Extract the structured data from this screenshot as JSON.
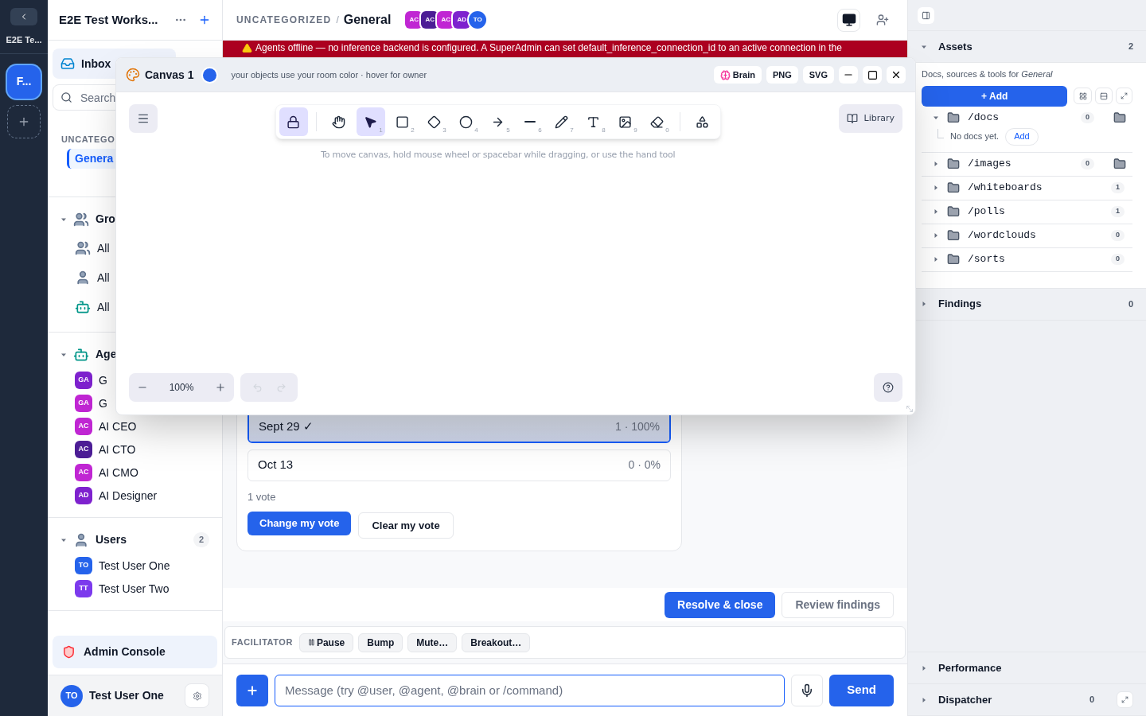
{
  "rail": {
    "title": "E2E Te...",
    "workspaces": [
      {
        "label": "F...",
        "selected": true
      }
    ]
  },
  "sidebar": {
    "workspace_title": "E2E Test Works...",
    "inbox": "Inbox",
    "search": {
      "placeholder": "Search"
    },
    "category": "UNCATEGO",
    "channels": [
      {
        "name": "Genera",
        "selected": true
      }
    ],
    "sections": [
      {
        "title": "Gro",
        "kind": "group",
        "expanded": true,
        "items": [
          {
            "kind": "group",
            "name": "All"
          },
          {
            "kind": "user",
            "name": "All"
          },
          {
            "kind": "robot",
            "name": "All"
          }
        ]
      },
      {
        "title": "Age",
        "kind": "robot",
        "expanded": true,
        "items": [
          {
            "kind": "avatar",
            "initials": "GA",
            "color": "#7e22ce",
            "name": "G"
          },
          {
            "kind": "avatar",
            "initials": "GA",
            "color": "#c026d3",
            "name": "G"
          },
          {
            "kind": "avatar",
            "initials": "AC",
            "color": "#c026d3",
            "name": "AI CEO"
          },
          {
            "kind": "avatar",
            "initials": "AC",
            "color": "#4c1d95",
            "name": "AI CTO"
          },
          {
            "kind": "avatar",
            "initials": "AC",
            "color": "#c026d3",
            "name": "AI CMO"
          },
          {
            "kind": "avatar",
            "initials": "AD",
            "color": "#7e22ce",
            "name": "AI Designer"
          }
        ]
      },
      {
        "title": "Users",
        "kind": "user",
        "expanded": true,
        "count": "2",
        "items": [
          {
            "kind": "avatar",
            "initials": "TO",
            "color": "#2563eb",
            "name": "Test User One"
          },
          {
            "kind": "avatar",
            "initials": "TT",
            "color": "#7c3aed",
            "name": "Test User Two"
          }
        ]
      }
    ],
    "admin": "Admin Console",
    "user": {
      "initials": "TO",
      "color": "#2563eb",
      "name": "Test User One"
    }
  },
  "header": {
    "category": "UNCATEGORIZED",
    "separator": "/",
    "title": "General",
    "members": [
      {
        "initials": "AC",
        "color": "#c026d3"
      },
      {
        "initials": "AC",
        "color": "#4c1d95"
      },
      {
        "initials": "AC",
        "color": "#c026d3"
      },
      {
        "initials": "AD",
        "color": "#7e22ce"
      },
      {
        "initials": "TO",
        "color": "#2563eb"
      }
    ]
  },
  "banner": "Agents offline — no inference backend is configured. A SuperAdmin can set default_inference_connection_id to an active connection in the",
  "canvas": {
    "title": "Canvas 1",
    "color": "#2563eb",
    "hint": "your objects use your room color · hover for owner",
    "actions": [
      "Brain",
      "PNG",
      "SVG"
    ],
    "tools": [
      {
        "kind": "lock",
        "selected": true
      },
      {
        "kind": "hand",
        "selected": false
      },
      {
        "kind": "select",
        "key": "1",
        "selected": true
      },
      {
        "kind": "rectangle",
        "key": "2",
        "selected": false
      },
      {
        "kind": "diamond",
        "key": "3",
        "selected": false
      },
      {
        "kind": "ellipse",
        "key": "4",
        "selected": false
      },
      {
        "kind": "arrow",
        "key": "5",
        "selected": false
      },
      {
        "kind": "line",
        "key": "6",
        "selected": false
      },
      {
        "kind": "draw",
        "key": "7",
        "selected": false
      },
      {
        "kind": "text",
        "key": "8",
        "selected": false
      },
      {
        "kind": "image",
        "key": "9",
        "selected": false
      },
      {
        "kind": "eraser",
        "key": "0",
        "selected": false
      },
      {
        "kind": "shapes",
        "selected": false
      }
    ],
    "library": "Library",
    "tip": "To move canvas, hold mouse wheel or spacebar while dragging, or use the hand tool",
    "zoom": "100%"
  },
  "poll": {
    "options": [
      {
        "label": "Sept 29 ✓",
        "result": "1 · 100%",
        "selected": true,
        "level": 1
      },
      {
        "label": "Oct 13",
        "result": "0 · 0%",
        "selected": false,
        "level": 0
      }
    ],
    "votes": "1 vote",
    "change": "Change my vote",
    "clear": "Clear my vote"
  },
  "resolve_bar": [
    {
      "kind": "primary",
      "label": "Resolve & close"
    },
    {
      "kind": "secondary",
      "label": "Review findings"
    }
  ],
  "facilitator": {
    "label": "FACILITATOR",
    "buttons": [
      {
        "kind": "pause",
        "label": "Pause"
      },
      {
        "kind": "plain",
        "label": "Bump"
      },
      {
        "kind": "plain",
        "label": "Mute…"
      },
      {
        "kind": "plain",
        "label": "Breakout…"
      }
    ]
  },
  "composer": {
    "placeholder": "Message (try @user, @agent, @brain or /command)",
    "send": "Send"
  },
  "right_panel": {
    "assets": {
      "title": "Assets",
      "count": "2",
      "expanded": true,
      "description": "Docs, sources & tools for *General*",
      "add": "+ Add",
      "folders": [
        {
          "name": "/docs",
          "count": "0",
          "expanded": true,
          "addable": true,
          "empty": "No docs yet.",
          "empty_action": "Add"
        },
        {
          "name": "/images",
          "count": "0",
          "expanded": false,
          "addable": true
        },
        {
          "name": "/whiteboards",
          "count": "1",
          "expanded": false,
          "addable": false
        },
        {
          "name": "/polls",
          "count": "1",
          "expanded": false,
          "addable": false
        },
        {
          "name": "/wordclouds",
          "count": "0",
          "expanded": false,
          "addable": false
        },
        {
          "name": "/sorts",
          "count": "0",
          "expanded": false,
          "addable": false
        }
      ]
    },
    "findings": {
      "title": "Findings",
      "count": "0",
      "expanded": false
    },
    "performance": {
      "title": "Performance",
      "expanded": false
    },
    "dispatcher": {
      "title": "Dispatcher",
      "count": "0",
      "expanded": false
    }
  }
}
